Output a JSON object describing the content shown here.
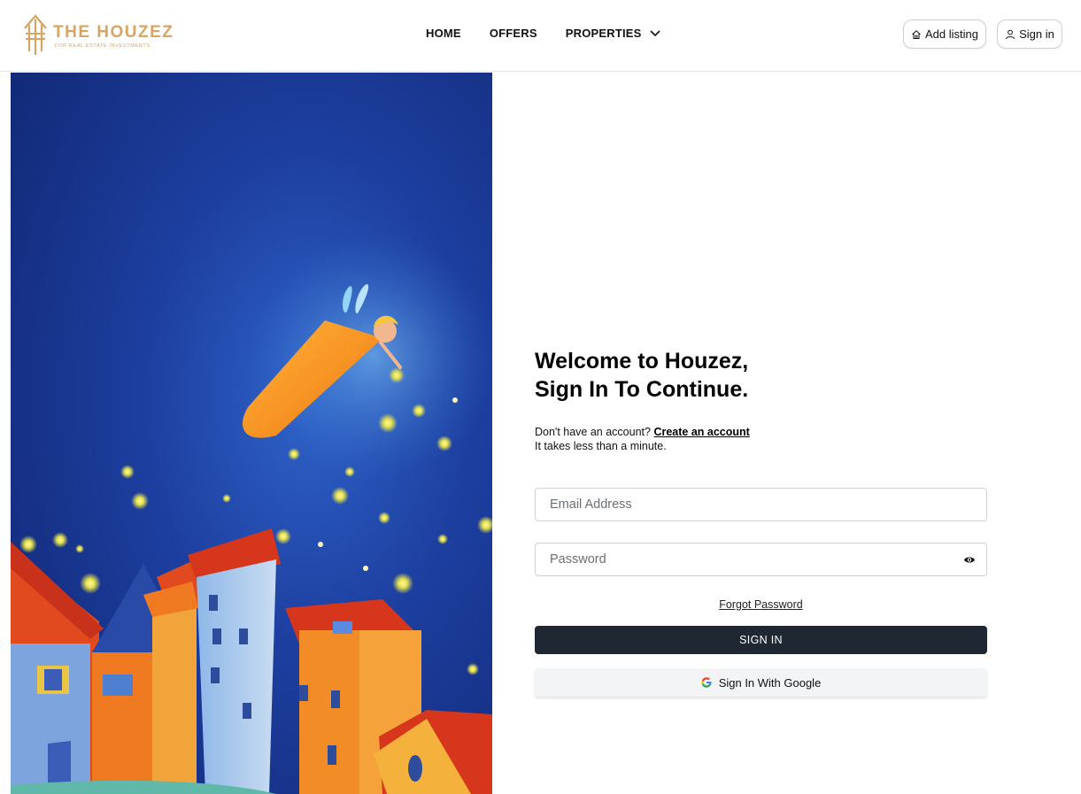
{
  "brand": {
    "name": "THE HOUZEZ",
    "tagline": "FOR REAL ESTATE INVESTMENTS",
    "color": "#d8a463"
  },
  "nav": {
    "items": [
      {
        "label": "HOME"
      },
      {
        "label": "OFFERS"
      },
      {
        "label": "PROPERTIES",
        "icon": "chevron-down-icon"
      }
    ]
  },
  "header_actions": {
    "add_listing": {
      "label": "Add listing",
      "icon": "house-icon"
    },
    "sign_in": {
      "label": "Sign in",
      "icon": "user-icon"
    }
  },
  "form": {
    "heading_line1": "Welcome to Houzez,",
    "heading_line2": "Sign In To Continue.",
    "no_account_text": "Don't have an account?",
    "create_account_link": "Create an account",
    "takes_less": "It takes less than a minute.",
    "email_placeholder": "Email Address",
    "password_placeholder": "Password",
    "forgot_password": "Forgot Password",
    "submit_label": "SIGN IN",
    "google_label": "Sign In With Google",
    "primary_color": "#1f2733"
  }
}
